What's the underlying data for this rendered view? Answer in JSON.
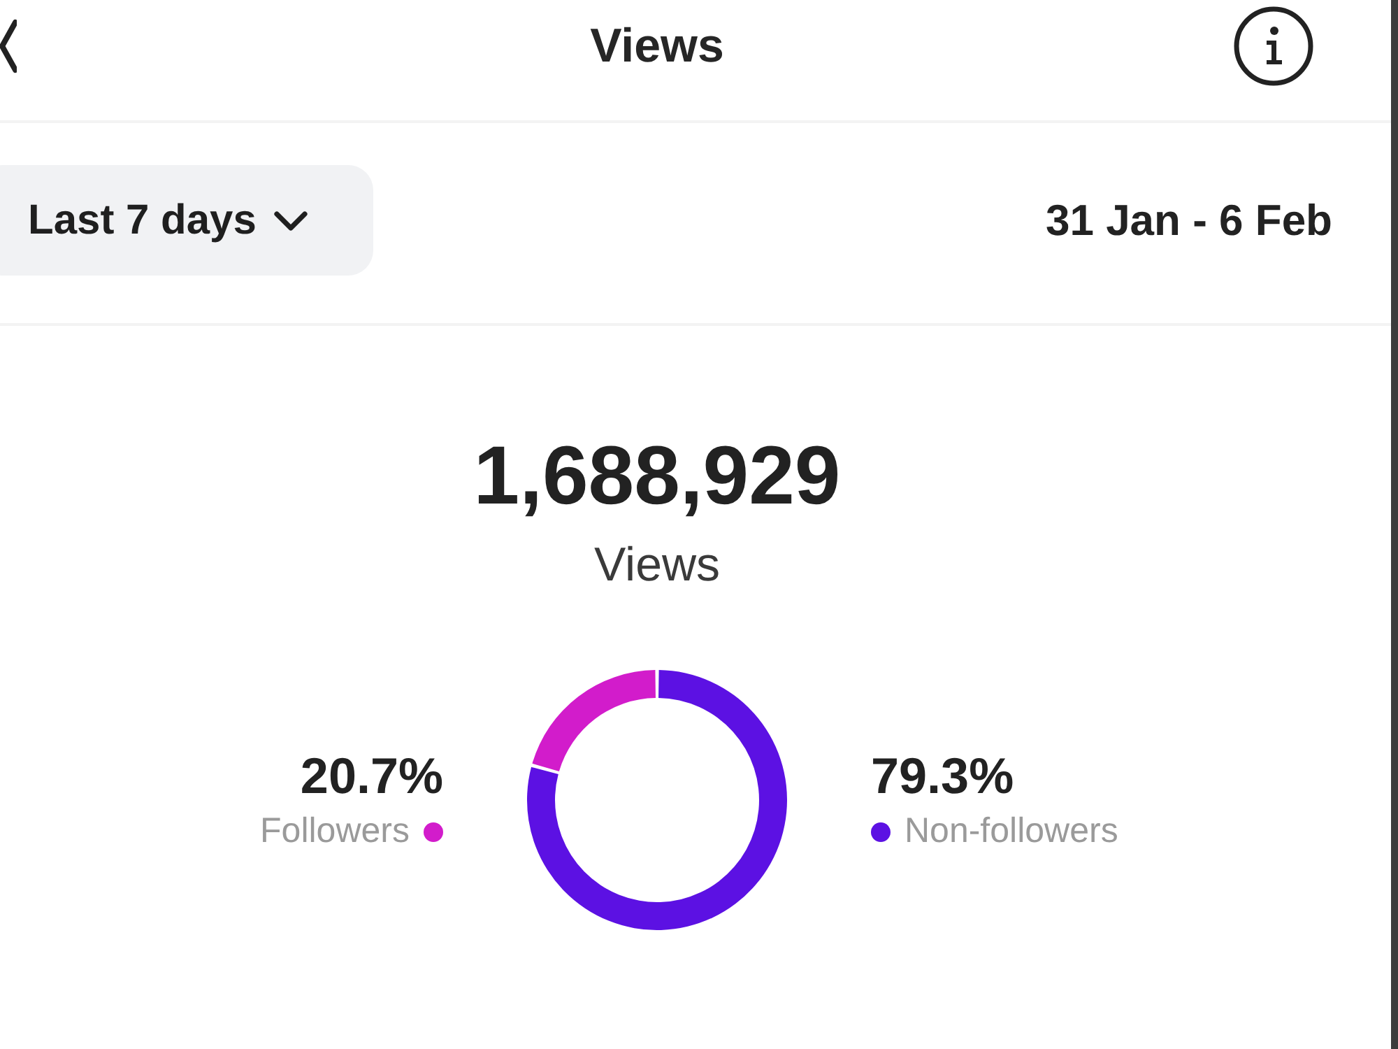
{
  "header": {
    "title": "Views"
  },
  "filter": {
    "period": "Last 7 days",
    "date_range": "31 Jan - 6 Feb"
  },
  "summary": {
    "total": "1,688,929",
    "label": "Views"
  },
  "audience": {
    "chart_data": {
      "type": "donut",
      "categories": [
        "Followers",
        "Non-followers"
      ],
      "values": [
        20.7,
        79.3
      ]
    },
    "legend": [
      {
        "value": "20.7%",
        "color": "#d21ccb"
      },
      {
        "value": "79.3%",
        "color": "#5c11e3"
      }
    ]
  }
}
